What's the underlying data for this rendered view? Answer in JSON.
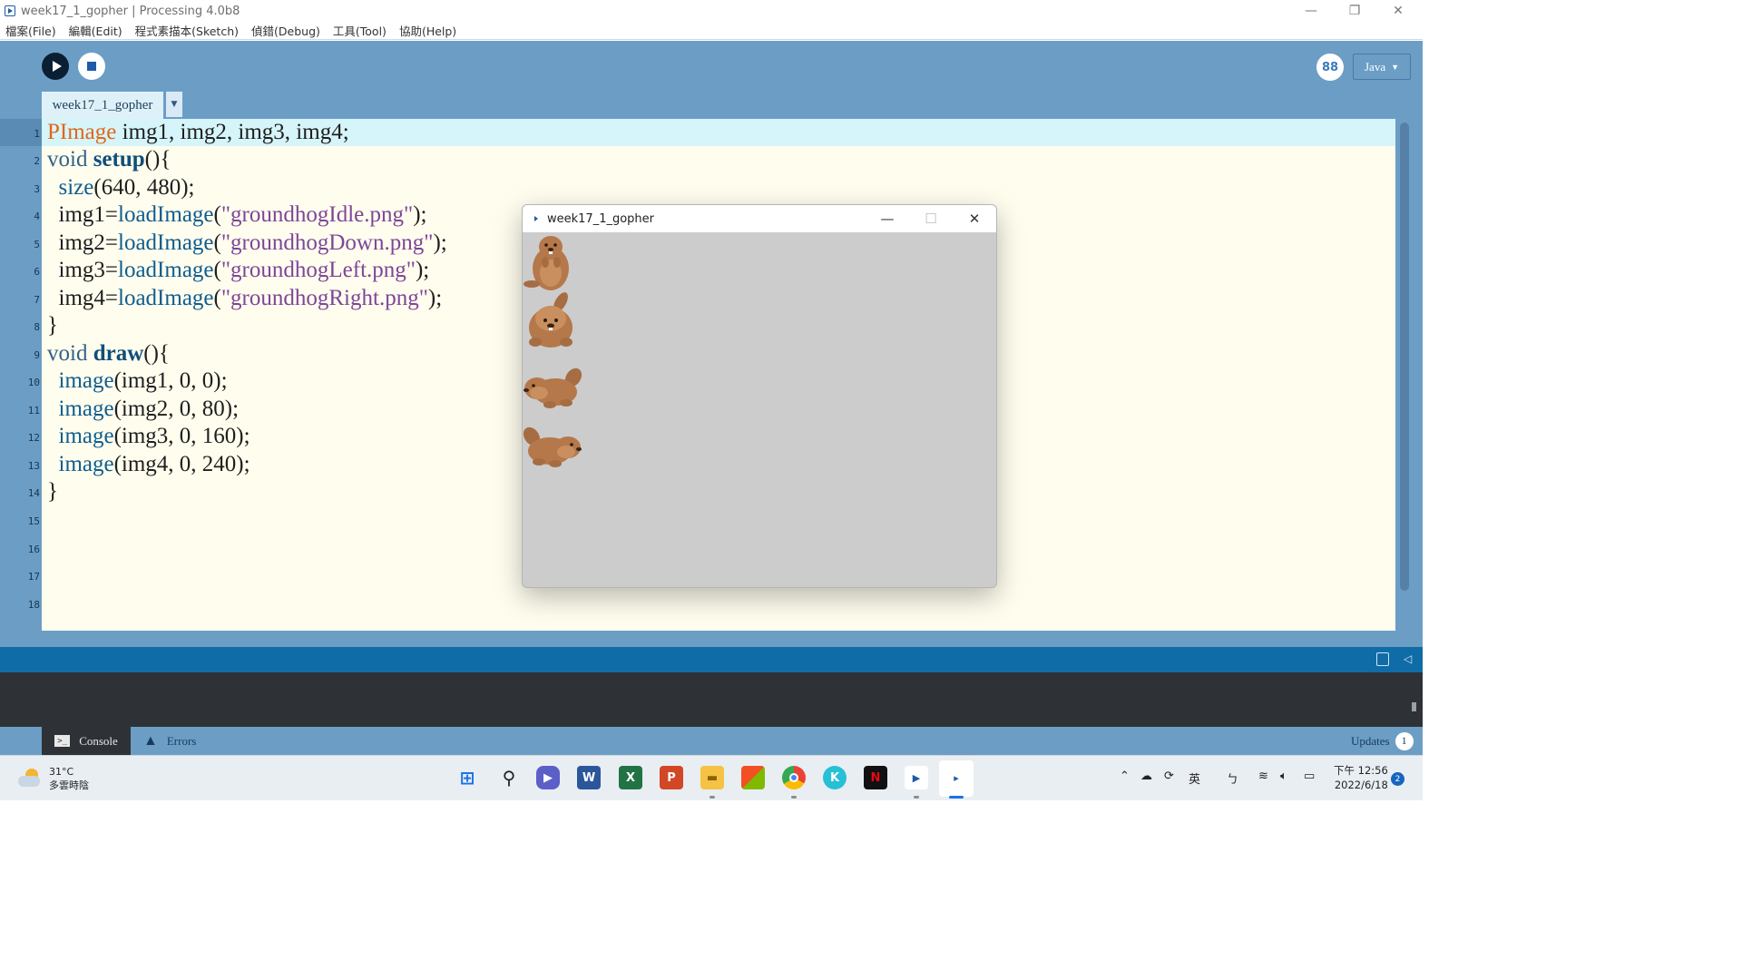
{
  "window": {
    "title": "week17_1_gopher | Processing 4.0b8"
  },
  "menu": [
    "檔案(File)",
    "編輯(Edit)",
    "程式素描本(Sketch)",
    "偵錯(Debug)",
    "工具(Tool)",
    "協助(Help)"
  ],
  "toolbar": {
    "mode": "Java",
    "debug_glyph": "88"
  },
  "editor": {
    "tab_name": "week17_1_gopher",
    "line_numbers": [
      "1",
      "2",
      "3",
      "4",
      "5",
      "6",
      "7",
      "8",
      "9",
      "10",
      "11",
      "12",
      "13",
      "14",
      "15",
      "16",
      "17",
      "18"
    ],
    "code": {
      "l1_type": "PImage",
      "l1_rest": " img1, img2, img3, img4;",
      "l2_kw": "void",
      "l2_fn": "setup",
      "l2_rest": "(){",
      "l3_indent": "  ",
      "l3_fn": "size",
      "l3_rest": "(640, 480);",
      "l4_indent": "  img1=",
      "l4_fn": "loadImage",
      "l4_open": "(",
      "l4_str": "\"groundhogIdle.png\"",
      "l4_close": ");",
      "l5_indent": "  img2=",
      "l5_fn": "loadImage",
      "l5_open": "(",
      "l5_str": "\"groundhogDown.png\"",
      "l5_close": ");",
      "l6_indent": "  img3=",
      "l6_fn": "loadImage",
      "l6_open": "(",
      "l6_str": "\"groundhogLeft.png\"",
      "l6_close": ");",
      "l7_indent": "  img4=",
      "l7_fn": "loadImage",
      "l7_open": "(",
      "l7_str": "\"groundhogRight.png\"",
      "l7_close": ");",
      "l8": "}",
      "l9_kw": "void",
      "l9_fn": "draw",
      "l9_rest": "(){",
      "l10_indent": "  ",
      "l10_fn": "image",
      "l10_rest": "(img1, 0, 0);",
      "l11_indent": "  ",
      "l11_fn": "image",
      "l11_rest": "(img2, 0, 80);",
      "l12_indent": "  ",
      "l12_fn": "image",
      "l12_rest": "(img3, 0, 160);",
      "l13_indent": "  ",
      "l13_fn": "image",
      "l13_rest": "(img4, 0, 240);",
      "l14": "}"
    }
  },
  "sketch_window": {
    "title": "week17_1_gopher",
    "sprites": [
      "groundhog-idle",
      "groundhog-down",
      "groundhog-left",
      "groundhog-right"
    ]
  },
  "console_panel": {
    "tabs": {
      "console": "Console",
      "errors": "Errors"
    },
    "updates_label": "Updates",
    "updates_count": "1"
  },
  "taskbar": {
    "weather_temp": "31°C",
    "weather_desc": "多雲時陰",
    "ime_label": "英",
    "ime_mode": "ㄅ",
    "time": "下午 12:56",
    "date": "2022/6/18",
    "notification_count": "2",
    "apps": [
      "start",
      "search",
      "teams",
      "word",
      "excel",
      "powerpoint",
      "file-explorer",
      "store",
      "chrome",
      "kingsoft",
      "netflix",
      "vscode-like",
      "processing"
    ]
  },
  "colors": {
    "accent": "#6c9ec5",
    "message_bar": "#106ca7",
    "console_bg": "#2e3236",
    "editor_bg": "#fffdee",
    "current_line": "#d6f5fa",
    "sketch_bg": "#cccccc"
  }
}
